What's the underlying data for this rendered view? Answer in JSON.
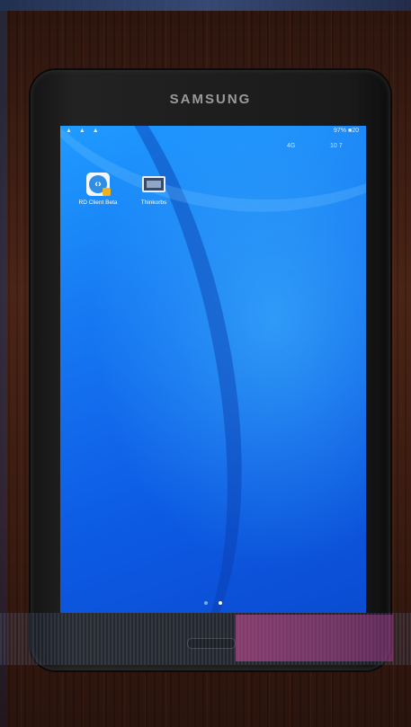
{
  "brand": "SAMSUNG",
  "status_bar": {
    "left_icons": "▲ ▲ ▲",
    "battery": "97%",
    "time": "■20",
    "line2_left": "4G",
    "line2_right": "10 7"
  },
  "apps": [
    {
      "label": "RD Client Beta",
      "icon": "remote-desktop-icon"
    },
    {
      "label": "Thinkorbs",
      "icon": "monitor-icon"
    }
  ],
  "page_indicator": {
    "pages": 2,
    "active": 1
  },
  "colors": {
    "screen": "#1677f2",
    "bezel": "#1a1a1a",
    "wood": "#3a1d12"
  }
}
